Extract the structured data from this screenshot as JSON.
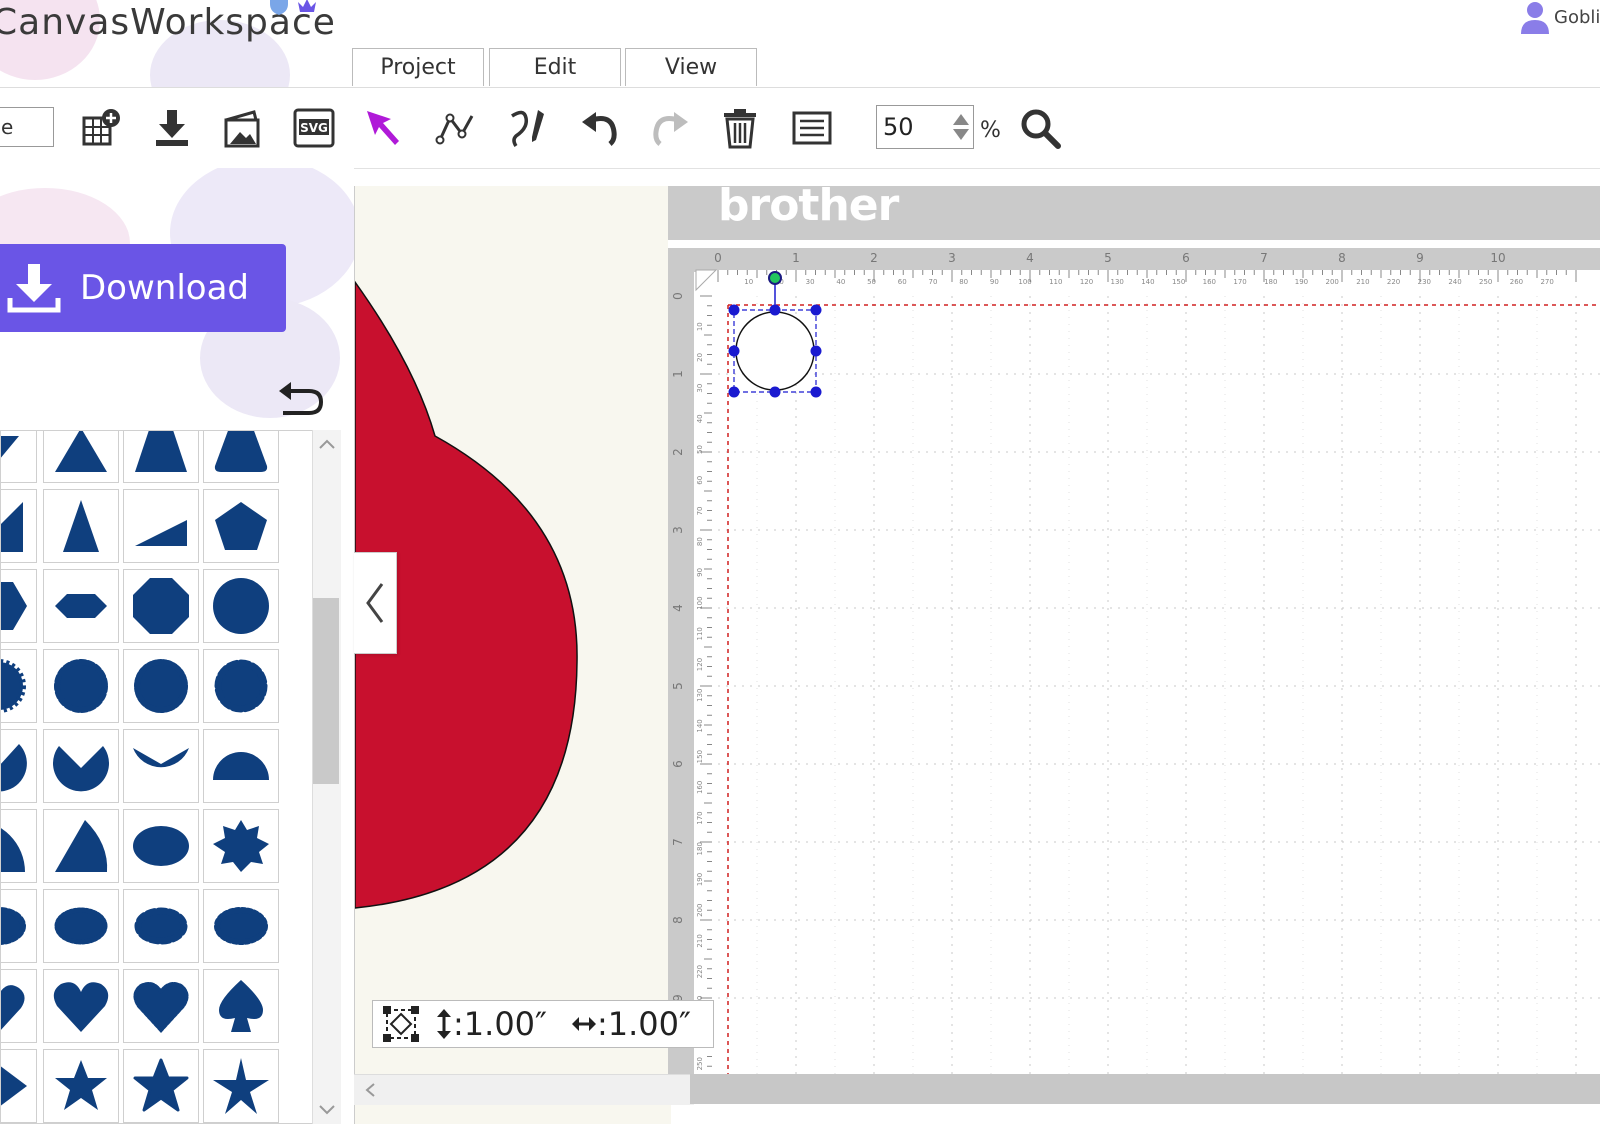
{
  "header": {
    "app_title": "CanvasWorkspace",
    "tabs": [
      {
        "label": "Project"
      },
      {
        "label": "Edit"
      },
      {
        "label": "View"
      }
    ],
    "user_name": "Gobli"
  },
  "toolbar": {
    "name_field_value": "e",
    "zoom_value": "50",
    "zoom_unit": "%",
    "icons": [
      "new-grid-icon",
      "import-icon",
      "image-trace-icon",
      "svg-import-icon",
      "select-arrow-icon",
      "node-edit-icon",
      "draw-pen-icon",
      "undo-icon",
      "redo-icon",
      "delete-icon",
      "align-menu-icon",
      "zoom-icon"
    ]
  },
  "left_panel": {
    "download_label": "Download",
    "undo_icon": "undo-arrow-icon"
  },
  "size_readout": {
    "height_text": ":1.00″",
    "width_text": ":1.00″"
  },
  "mat": {
    "brand": "brother",
    "ruler_top_major": [
      "0",
      "1",
      "2",
      "3",
      "4",
      "5",
      "6",
      "7",
      "8",
      "9",
      "10"
    ],
    "ruler_top_minor": [
      "10",
      "20",
      "30",
      "40",
      "50",
      "60",
      "70",
      "80",
      "90",
      "100",
      "110",
      "120",
      "130",
      "140",
      "150",
      "160",
      "170",
      "180",
      "190",
      "200",
      "210",
      "220",
      "230",
      "240",
      "250",
      "260",
      "270"
    ],
    "ruler_left_major": [
      "0",
      "1",
      "2",
      "3",
      "4",
      "5",
      "6",
      "7",
      "8",
      "9"
    ],
    "ruler_left_minor": [
      "10",
      "20",
      "30",
      "40",
      "50",
      "60",
      "70",
      "80",
      "90",
      "100",
      "110",
      "120",
      "130",
      "140",
      "150",
      "160",
      "170",
      "180",
      "190",
      "200",
      "210",
      "220",
      "230",
      "240",
      "250"
    ]
  },
  "colors": {
    "accent": "#6a55e6",
    "shape_fill": "#0f3f7e",
    "preview_red": "#c8102e",
    "selection": "#1a1ad0",
    "rotate_handle": "#22c55e",
    "cut_line": "#d02020"
  }
}
